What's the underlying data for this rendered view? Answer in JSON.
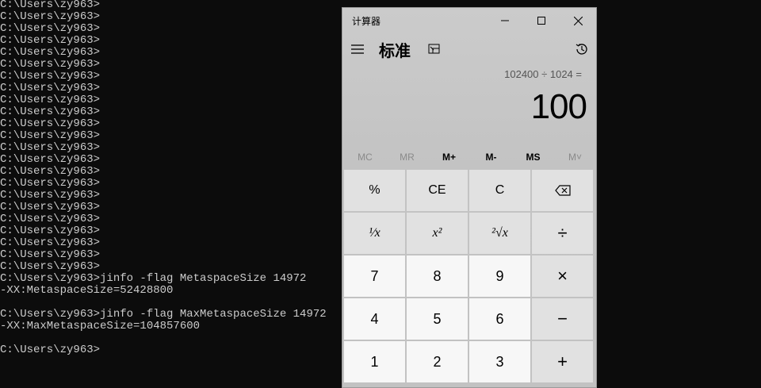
{
  "terminal": {
    "lines": [
      "C:\\Users\\zy963>",
      "C:\\Users\\zy963>",
      "C:\\Users\\zy963>",
      "C:\\Users\\zy963>",
      "C:\\Users\\zy963>",
      "C:\\Users\\zy963>",
      "C:\\Users\\zy963>",
      "C:\\Users\\zy963>",
      "C:\\Users\\zy963>",
      "C:\\Users\\zy963>",
      "C:\\Users\\zy963>",
      "C:\\Users\\zy963>",
      "C:\\Users\\zy963>",
      "C:\\Users\\zy963>",
      "C:\\Users\\zy963>",
      "C:\\Users\\zy963>",
      "C:\\Users\\zy963>",
      "C:\\Users\\zy963>",
      "C:\\Users\\zy963>",
      "C:\\Users\\zy963>",
      "C:\\Users\\zy963>",
      "C:\\Users\\zy963>",
      "C:\\Users\\zy963>",
      "C:\\Users\\zy963>jinfo -flag MetaspaceSize 14972",
      "-XX:MetaspaceSize=52428800",
      "",
      "C:\\Users\\zy963>jinfo -flag MaxMetaspaceSize 14972",
      "-XX:MaxMetaspaceSize=104857600",
      "",
      "C:\\Users\\zy963>"
    ]
  },
  "calculator": {
    "window_title": "计算器",
    "mode_title": "标准",
    "expression": "102400 ÷ 1024 =",
    "result": "100",
    "memory": [
      "MC",
      "MR",
      "M+",
      "M-",
      "MS",
      "M˅"
    ],
    "keys": [
      [
        "%",
        "CE",
        "C",
        "⌫"
      ],
      [
        "¹⁄x",
        "x²",
        "²√x",
        "÷"
      ],
      [
        "7",
        "8",
        "9",
        "×"
      ],
      [
        "4",
        "5",
        "6",
        "−"
      ],
      [
        "1",
        "2",
        "3",
        "+"
      ]
    ]
  },
  "icons": [
    "hamburger-menu-icon",
    "keep-on-top-icon",
    "history-icon",
    "minimize-icon",
    "maximize-icon",
    "close-icon",
    "backspace-icon"
  ]
}
